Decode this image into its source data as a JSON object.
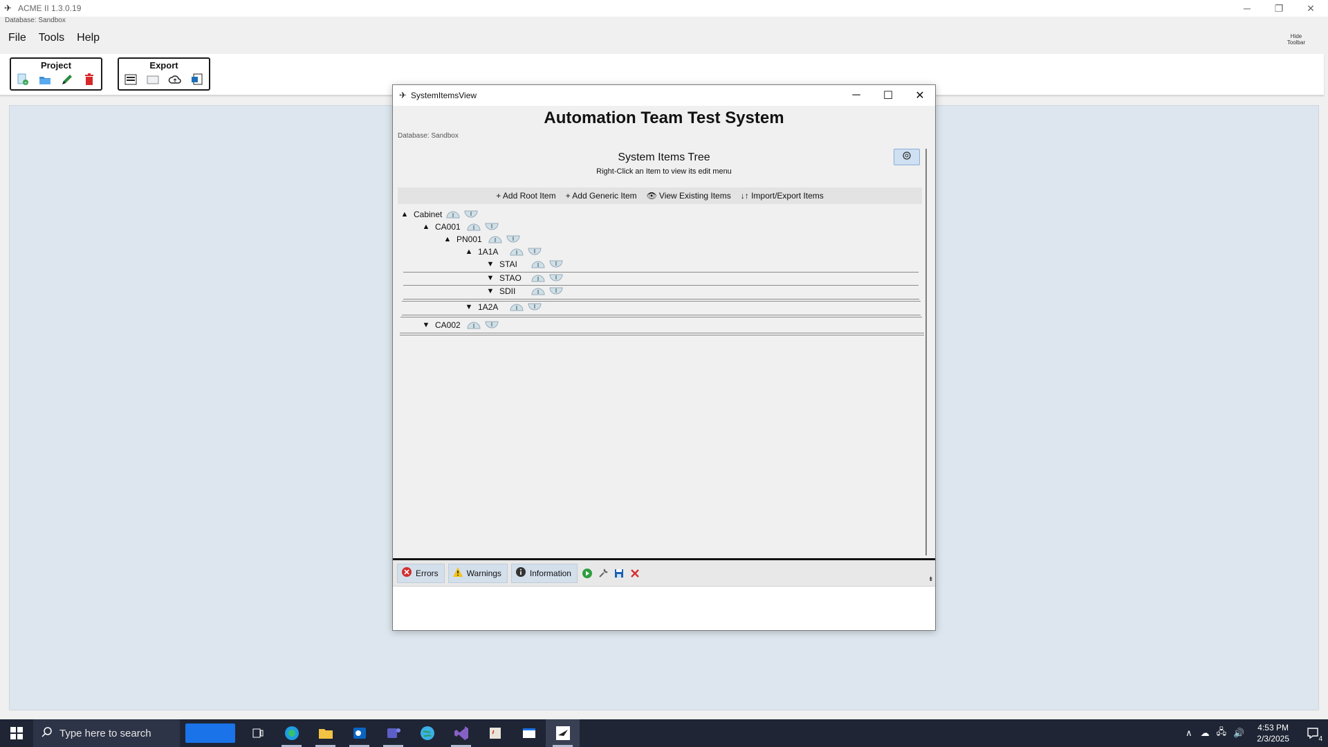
{
  "app": {
    "title": "ACME II 1.3.0.19",
    "database_label": "Database: Sandbox"
  },
  "menu": [
    "File",
    "Tools",
    "Help"
  ],
  "hide_toolbar": {
    "line1": "Hide",
    "line2": "Toolbar"
  },
  "toolbar": {
    "project_label": "Project",
    "export_label": "Export"
  },
  "child_window": {
    "title": "SystemItemsView",
    "system_title": "Automation Team Test System",
    "database_label": "Database: Sandbox",
    "tree_title": "System Items Tree",
    "tree_subtitle": "Right-Click an Item to view its edit menu",
    "actions": {
      "add_root": "+ Add Root Item",
      "add_generic": "+ Add Generic Item",
      "view_existing": "View Existing Items",
      "import_export": "↓↑ Import/Export Items"
    },
    "tree": [
      {
        "label": "Cabinet",
        "expanded": true
      },
      {
        "label": "CA001",
        "expanded": true
      },
      {
        "label": "PN001",
        "expanded": true
      },
      {
        "label": "1A1A",
        "expanded": true
      },
      {
        "label": "STAI",
        "expanded": false
      },
      {
        "label": "STAO",
        "expanded": false
      },
      {
        "label": "SDII",
        "expanded": false
      },
      {
        "label": "1A2A",
        "expanded": false
      },
      {
        "label": "CA002",
        "expanded": false
      }
    ],
    "log_tabs": {
      "errors": "Errors",
      "warnings": "Warnings",
      "information": "Information"
    }
  },
  "taskbar": {
    "search_placeholder": "Type here to search",
    "time": "4:53 PM",
    "date": "2/3/2025",
    "notification_count": "4"
  },
  "colors": {
    "workspace": "#dde6ee",
    "taskbar": "#1f2535",
    "accent_blue": "#1a73e8"
  }
}
